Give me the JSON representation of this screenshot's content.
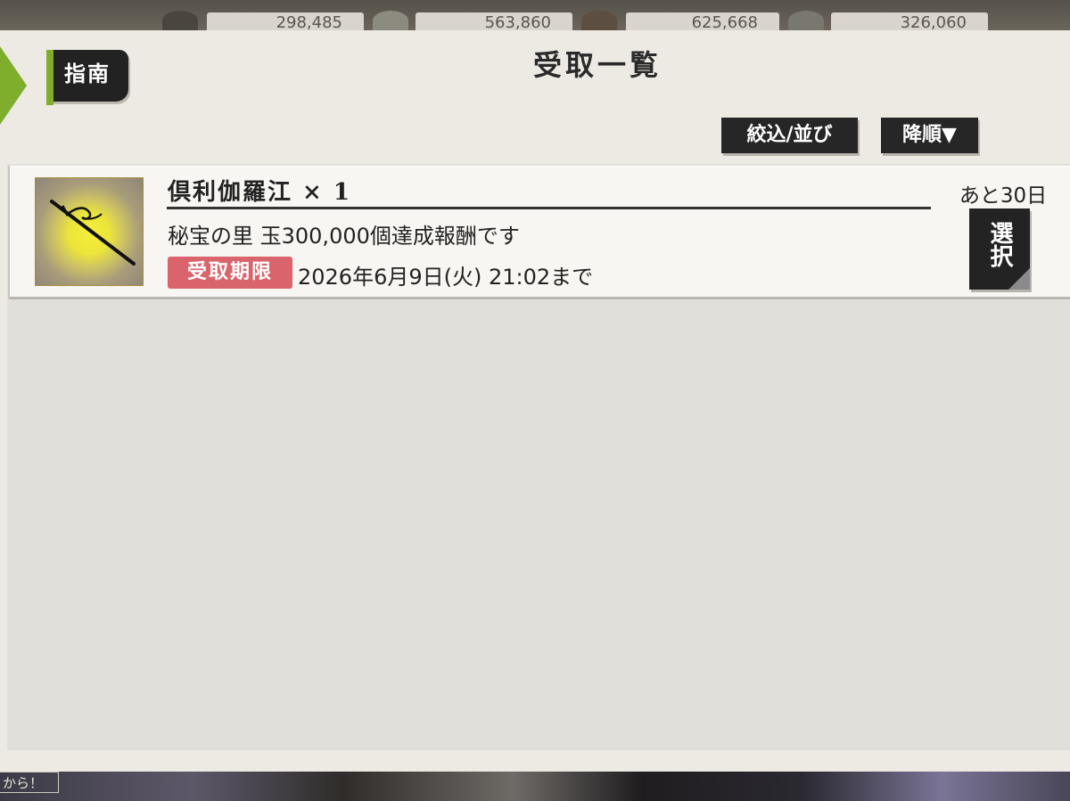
{
  "resources": {
    "amounts": [
      "298,485",
      "563,860",
      "625,668",
      "326,060"
    ]
  },
  "panel": {
    "title": "受取一覧",
    "guide_label": "指南",
    "filter_label": "絞込/並び",
    "sort_label": "降順▼"
  },
  "items": [
    {
      "name": "倶利伽羅江 × 1",
      "description": "秘宝の里 玉300,000個達成報酬です",
      "deadline_label": "受取期限",
      "deadline": "2026年6月9日(火) 21:02まで",
      "remaining": "あと30日",
      "select_label": "選択",
      "icon": "sword-icon"
    }
  ],
  "background": {
    "bottom_tag": "から！"
  },
  "colors": {
    "accent_green": "#7fae2c",
    "deadline_red": "#d9646b",
    "button_dark": "#262626",
    "panel_bg": "#eceae3"
  }
}
